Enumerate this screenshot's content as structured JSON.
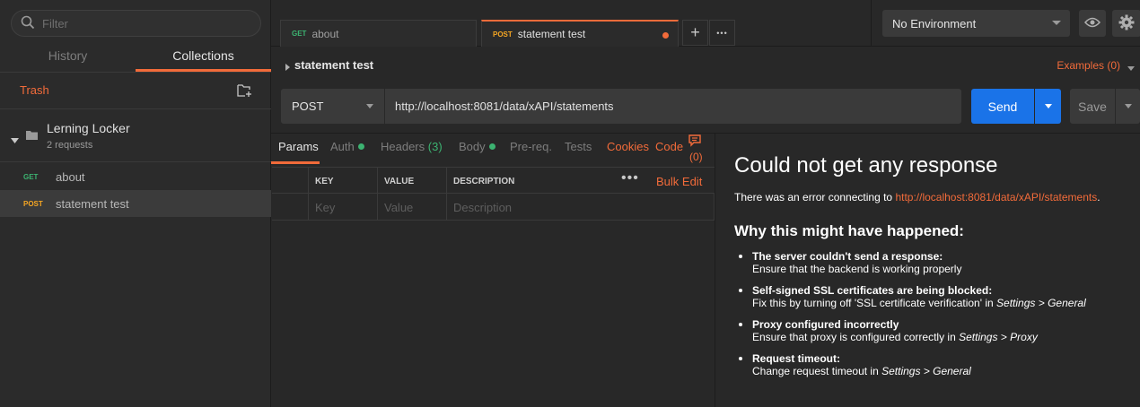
{
  "sidebar": {
    "search_placeholder": "Filter",
    "tabs": [
      {
        "label": "History"
      },
      {
        "label": "Collections"
      }
    ],
    "trash_label": "Trash",
    "collection": {
      "name": "Lerning Locker",
      "count": "2 requests"
    },
    "requests": [
      {
        "method": "GET",
        "name": "about"
      },
      {
        "method": "POST",
        "name": "statement test"
      }
    ]
  },
  "tabbar": {
    "tabs": [
      {
        "method": "GET",
        "name": "about"
      },
      {
        "method": "POST",
        "name": "statement test"
      }
    ],
    "add_glyph": "+",
    "more_glyph": "•••"
  },
  "env": {
    "selected": "No Environment"
  },
  "request": {
    "name": "statement test",
    "examples_label": "Examples (0)",
    "method": "POST",
    "url": "http://localhost:8081/data/xAPI/statements",
    "send_label": "Send",
    "save_label": "Save",
    "tabs": {
      "params": "Params",
      "auth": "Auth",
      "headers": "Headers",
      "headers_count": "(3)",
      "body": "Body",
      "prereq": "Pre-req.",
      "tests": "Tests",
      "cookies": "Cookies",
      "code": "Code",
      "comments_count": "(0)"
    },
    "params_table": {
      "headers": [
        "KEY",
        "VALUE",
        "DESCRIPTION"
      ],
      "placeholders": [
        "Key",
        "Value",
        "Description"
      ],
      "more_glyph": "•••",
      "bulk_edit": "Bulk Edit"
    }
  },
  "response": {
    "title": "Could not get any response",
    "error_prefix": "There was an error connecting to ",
    "error_url": "http://localhost:8081/data/xAPI/statements",
    "error_suffix": ".",
    "why_title": "Why this might have happened:",
    "reasons": [
      {
        "title": "The server couldn't send a response:",
        "detail": "Ensure that the backend is working properly",
        "detail_em": ""
      },
      {
        "title": "Self-signed SSL certificates are being blocked:",
        "detail": "Fix this by turning off 'SSL certificate verification' in ",
        "detail_em": "Settings > General"
      },
      {
        "title": "Proxy configured incorrectly",
        "detail": "Ensure that proxy is configured correctly in ",
        "detail_em": "Settings > Proxy"
      },
      {
        "title": "Request timeout:",
        "detail": "Change request timeout in ",
        "detail_em": "Settings > General"
      }
    ]
  },
  "colors": {
    "accent": "#f26b3a",
    "send": "#1a73e8",
    "get": "#3cb371",
    "post": "#f5a623"
  }
}
